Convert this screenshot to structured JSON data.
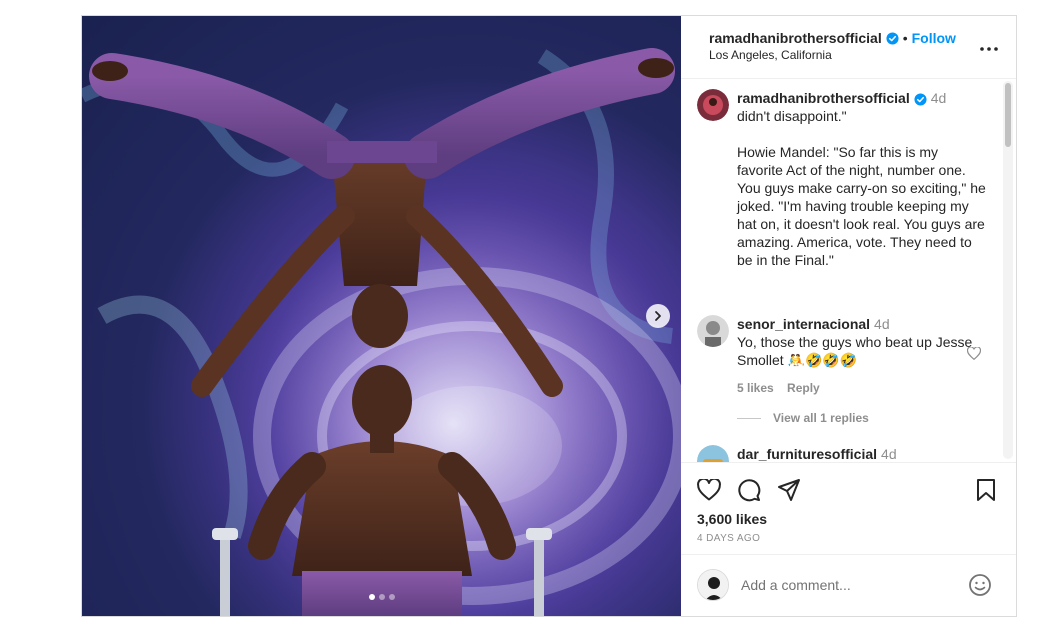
{
  "post": {
    "next_icon": "chevron-right-icon",
    "carousel": {
      "count": 3,
      "active": 1
    },
    "header": {
      "username": "ramadhanibrothersofficial",
      "separator": "•",
      "follow_label": "Follow",
      "location": "Los Angeles, California",
      "more_icon": "more-horizontal-icon"
    },
    "caption": {
      "username": "ramadhanibrothersofficial",
      "time": "4d",
      "text": "didn't disappoint.\"\n\nHowie Mandel: \"So far this is my favorite Act of the night, number one. You guys make carry-on so exciting,\" he joked. \"I'm having trouble keeping my hat on, it doesn't look real. You guys are amazing. America, vote. They need to be in the Final.\""
    },
    "comments": [
      {
        "username": "senor_internacional",
        "time": "4d",
        "text": "Yo, those the guys who beat up Jesse Smollet 🤼🤣🤣🤣",
        "likes": "5 likes",
        "reply_label": "Reply",
        "view_replies": "View all 1 replies"
      },
      {
        "username": "dar_furnituresofficial",
        "time": "4d"
      }
    ],
    "actions": {
      "like_icon": "heart-icon",
      "comment_icon": "comment-icon",
      "share_icon": "send-icon",
      "save_icon": "bookmark-icon",
      "likes_text": "3,600 likes",
      "date_text": "4 DAYS AGO"
    },
    "add_comment": {
      "placeholder": "Add a comment...",
      "emoji_icon": "emoji-icon"
    },
    "colors": {
      "accent": "#0095f6",
      "text": "#262626",
      "muted": "#8e8e8e",
      "border": "#dbdbdb"
    }
  }
}
